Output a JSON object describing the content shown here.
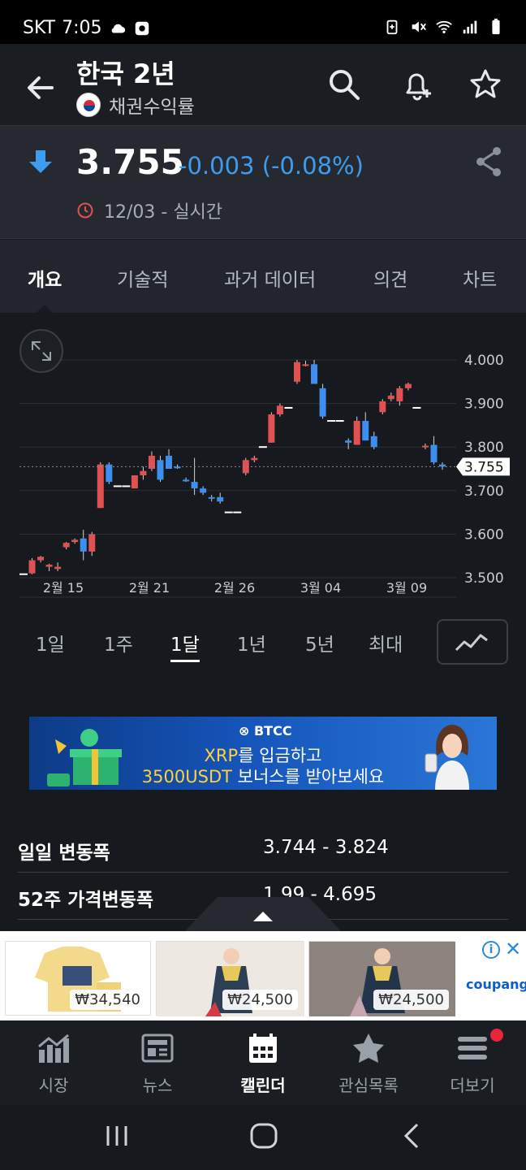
{
  "status_bar": {
    "carrier": "SKT",
    "time": "7:05"
  },
  "header": {
    "title": "한국 2년",
    "subtitle": "채권수익률"
  },
  "quote": {
    "price": "3.755",
    "change": "-0.003 (-0.08%)",
    "timestamp": "12/03 - 실시간",
    "direction": "down",
    "change_color": "#3d9cf0"
  },
  "tabs": [
    "개요",
    "기술적",
    "과거 데이터",
    "의견",
    "차트"
  ],
  "active_tab": "개요",
  "chart_data": {
    "type": "candlestick",
    "x_labels": [
      "2월 15",
      "2월 21",
      "2월 26",
      "3월 04",
      "3월 09"
    ],
    "y_ticks": [
      "4.000",
      "3.900",
      "3.800",
      "3.700",
      "3.600",
      "3.500"
    ],
    "ylim": [
      3.5,
      4.0
    ],
    "current_value_label": "3.755",
    "current_value": 3.755,
    "up_color": "#e05252",
    "down_color": "#3d8fef",
    "candles": [
      {
        "o": 3.505,
        "h": 3.51,
        "l": 3.503,
        "c": 3.508
      },
      {
        "o": 3.51,
        "h": 3.545,
        "l": 3.508,
        "c": 3.54
      },
      {
        "o": 3.54,
        "h": 3.55,
        "l": 3.535,
        "c": 3.548
      },
      {
        "o": 3.525,
        "h": 3.532,
        "l": 3.515,
        "c": 3.53
      },
      {
        "o": 3.52,
        "h": 3.535,
        "l": 3.515,
        "c": 3.525
      },
      {
        "o": 3.57,
        "h": 3.582,
        "l": 3.565,
        "c": 3.58
      },
      {
        "o": 3.582,
        "h": 3.59,
        "l": 3.578,
        "c": 3.587
      },
      {
        "o": 3.59,
        "h": 3.61,
        "l": 3.54,
        "c": 3.56
      },
      {
        "o": 3.56,
        "h": 3.605,
        "l": 3.55,
        "c": 3.6
      },
      {
        "o": 3.66,
        "h": 3.765,
        "l": 3.66,
        "c": 3.76
      },
      {
        "o": 3.76,
        "h": 3.765,
        "l": 3.715,
        "c": 3.72
      },
      {
        "o": 3.71,
        "h": 3.713,
        "l": 3.708,
        "c": 3.71
      },
      {
        "o": 3.71,
        "h": 3.713,
        "l": 3.708,
        "c": 3.71
      },
      {
        "o": 3.705,
        "h": 3.735,
        "l": 3.705,
        "c": 3.735
      },
      {
        "o": 3.735,
        "h": 3.755,
        "l": 3.725,
        "c": 3.745
      },
      {
        "o": 3.75,
        "h": 3.79,
        "l": 3.745,
        "c": 3.78
      },
      {
        "o": 3.77,
        "h": 3.78,
        "l": 3.72,
        "c": 3.725
      },
      {
        "o": 3.78,
        "h": 3.795,
        "l": 3.75,
        "c": 3.75
      },
      {
        "o": 3.755,
        "h": 3.76,
        "l": 3.75,
        "c": 3.753
      },
      {
        "o": 3.725,
        "h": 3.73,
        "l": 3.72,
        "c": 3.722
      },
      {
        "o": 3.72,
        "h": 3.775,
        "l": 3.69,
        "c": 3.705
      },
      {
        "o": 3.705,
        "h": 3.71,
        "l": 3.69,
        "c": 3.695
      },
      {
        "o": 3.685,
        "h": 3.69,
        "l": 3.675,
        "c": 3.683
      },
      {
        "o": 3.685,
        "h": 3.695,
        "l": 3.67,
        "c": 3.675
      },
      {
        "o": 3.65,
        "h": 3.653,
        "l": 3.648,
        "c": 3.65
      },
      {
        "o": 3.65,
        "h": 3.653,
        "l": 3.648,
        "c": 3.65
      },
      {
        "o": 3.74,
        "h": 3.775,
        "l": 3.735,
        "c": 3.77
      },
      {
        "o": 3.77,
        "h": 3.78,
        "l": 3.765,
        "c": 3.775
      },
      {
        "o": 3.8,
        "h": 3.803,
        "l": 3.797,
        "c": 3.8
      },
      {
        "o": 3.81,
        "h": 3.88,
        "l": 3.81,
        "c": 3.875
      },
      {
        "o": 3.875,
        "h": 3.9,
        "l": 3.87,
        "c": 3.895
      },
      {
        "o": 3.89,
        "h": 3.893,
        "l": 3.887,
        "c": 3.89
      },
      {
        "o": 3.95,
        "h": 4.0,
        "l": 3.945,
        "c": 3.995
      },
      {
        "o": 3.99,
        "h": 3.998,
        "l": 3.985,
        "c": 3.99
      },
      {
        "o": 3.99,
        "h": 4.0,
        "l": 3.945,
        "c": 3.945
      },
      {
        "o": 3.935,
        "h": 3.945,
        "l": 3.865,
        "c": 3.87
      },
      {
        "o": 3.86,
        "h": 3.863,
        "l": 3.857,
        "c": 3.86
      },
      {
        "o": 3.86,
        "h": 3.863,
        "l": 3.857,
        "c": 3.86
      },
      {
        "o": 3.815,
        "h": 3.82,
        "l": 3.795,
        "c": 3.81
      },
      {
        "o": 3.805,
        "h": 3.87,
        "l": 3.805,
        "c": 3.86
      },
      {
        "o": 3.86,
        "h": 3.88,
        "l": 3.815,
        "c": 3.815
      },
      {
        "o": 3.825,
        "h": 3.835,
        "l": 3.795,
        "c": 3.8
      },
      {
        "o": 3.88,
        "h": 3.91,
        "l": 3.875,
        "c": 3.905
      },
      {
        "o": 3.91,
        "h": 3.925,
        "l": 3.905,
        "c": 3.918
      },
      {
        "o": 3.905,
        "h": 3.94,
        "l": 3.895,
        "c": 3.935
      },
      {
        "o": 3.935,
        "h": 3.948,
        "l": 3.93,
        "c": 3.945
      },
      {
        "o": 3.89,
        "h": 3.893,
        "l": 3.887,
        "c": 3.89
      },
      {
        "o": 3.8,
        "h": 3.808,
        "l": 3.795,
        "c": 3.803
      },
      {
        "o": 3.805,
        "h": 3.825,
        "l": 3.76,
        "c": 3.765
      },
      {
        "o": 3.76,
        "h": 3.765,
        "l": 3.748,
        "c": 3.755
      }
    ]
  },
  "ranges": [
    "1일",
    "1주",
    "1달",
    "1년",
    "5년",
    "최대"
  ],
  "active_range": "1달",
  "ad_banner": {
    "brand": "BTCC",
    "line1_hl": "XRP",
    "line1": "를 입금하고",
    "line2_hl": "3500USDT",
    "line2": " 보너스를 받아보세요"
  },
  "stats": [
    {
      "label": "일일 변동폭",
      "value": "3.744 - 3.824"
    },
    {
      "label": "52주 가격변동폭",
      "value": "1.99 - 4.695"
    }
  ],
  "ad_products": [
    {
      "price": "₩34,540"
    },
    {
      "price": "₩24,500"
    },
    {
      "price": "₩24,500"
    }
  ],
  "ad_brand": "coupang",
  "bottom_nav": [
    {
      "label": "시장",
      "icon": "chart-bars-icon"
    },
    {
      "label": "뉴스",
      "icon": "news-icon"
    },
    {
      "label": "캘린더",
      "icon": "calendar-icon"
    },
    {
      "label": "관심목록",
      "icon": "star-icon"
    },
    {
      "label": "더보기",
      "icon": "menu-icon"
    }
  ],
  "active_nav": "캘린더"
}
